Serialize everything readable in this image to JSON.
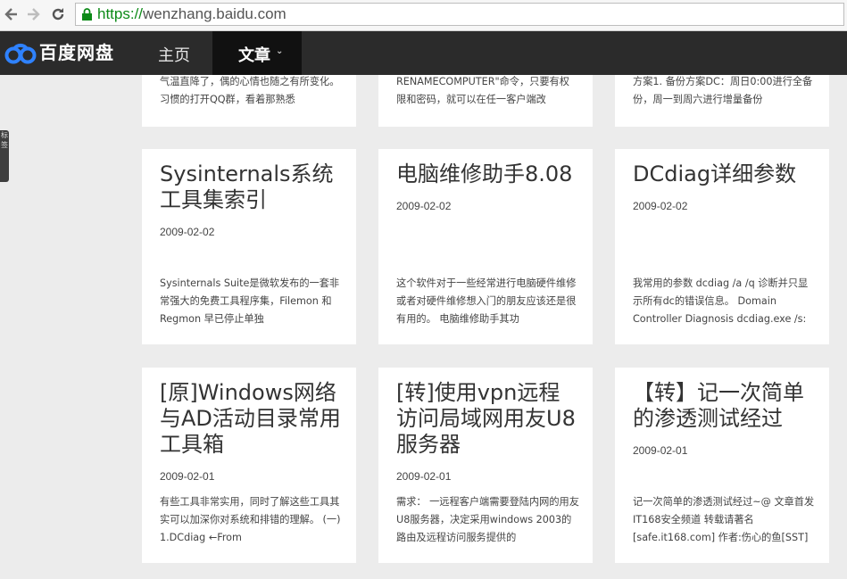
{
  "browser": {
    "url_scheme": "https://",
    "url_rest": "wenzhang.baidu.com",
    "back_icon": "back-arrow-icon",
    "forward_icon": "forward-arrow-icon",
    "reload_icon": "reload-icon"
  },
  "header": {
    "logo_text": "百度网盘",
    "nav": {
      "home": "主页",
      "article": "文章",
      "article_caret": "⌄"
    }
  },
  "sidetab": {
    "text": "标签"
  },
  "top_row": [
    {
      "excerpt": "气温直降了，偶的心情也随之有所变化。习惯的打开QQ群，看着那熟悉"
    },
    {
      "excerpt": "RENAMECOMPUTER\"命令，只要有权限和密码，就可以在任一客户端改"
    },
    {
      "excerpt": "方案1. 备份方案DC：周日0:00进行全备份，周一到周六进行增量备份"
    }
  ],
  "articles": [
    {
      "title": "Sysinternals系统工具集索引",
      "date": "2009-02-02",
      "excerpt": "Sysinternals Suite是微软发布的一套非常强大的免费工具程序集，Filemon 和 Regmon 早已停止单独"
    },
    {
      "title": "电脑维修助手8.08",
      "date": "2009-02-02",
      "excerpt": "这个软件对于一些经常进行电脑硬件维修或者对硬件维修想入门的朋友应该还是很有用的。 电脑维修助手其功"
    },
    {
      "title": "DCdiag详细参数",
      "date": "2009-02-02",
      "excerpt": "我常用的参数 dcdiag /a /q      诊断并只显示所有dc的错误信息。 Domain Controller Diagnosis dcdiag.exe /s:"
    },
    {
      "title": "[原]Windows网络与AD活动目录常用工具箱",
      "date": "2009-02-01",
      "excerpt": "有些工具非常实用，同时了解这些工具其实可以加深你对系统和排错的理解。 (一) 1.DCdiag ←From"
    },
    {
      "title": "[转]使用vpn远程访问局域网用友U8服务器",
      "date": "2009-02-01",
      "excerpt": "需求：     一远程客户端需要登陆内网的用友U8服务器，决定采用windows 2003的路由及远程访问服务提供的"
    },
    {
      "title": "【转】记一次简单的渗透测试经过",
      "date": "2009-02-01",
      "excerpt": "记一次简单的渗透测试经过~@ 文章首发IT168安全频道 转载请著名[safe.it168.com] 作者:伤心的鱼[SST]"
    }
  ],
  "colors": {
    "header_bg": "#2b2b2b",
    "active_nav_bg": "#111111",
    "page_bg": "#ececec",
    "secure_green": "#0c8a17"
  }
}
